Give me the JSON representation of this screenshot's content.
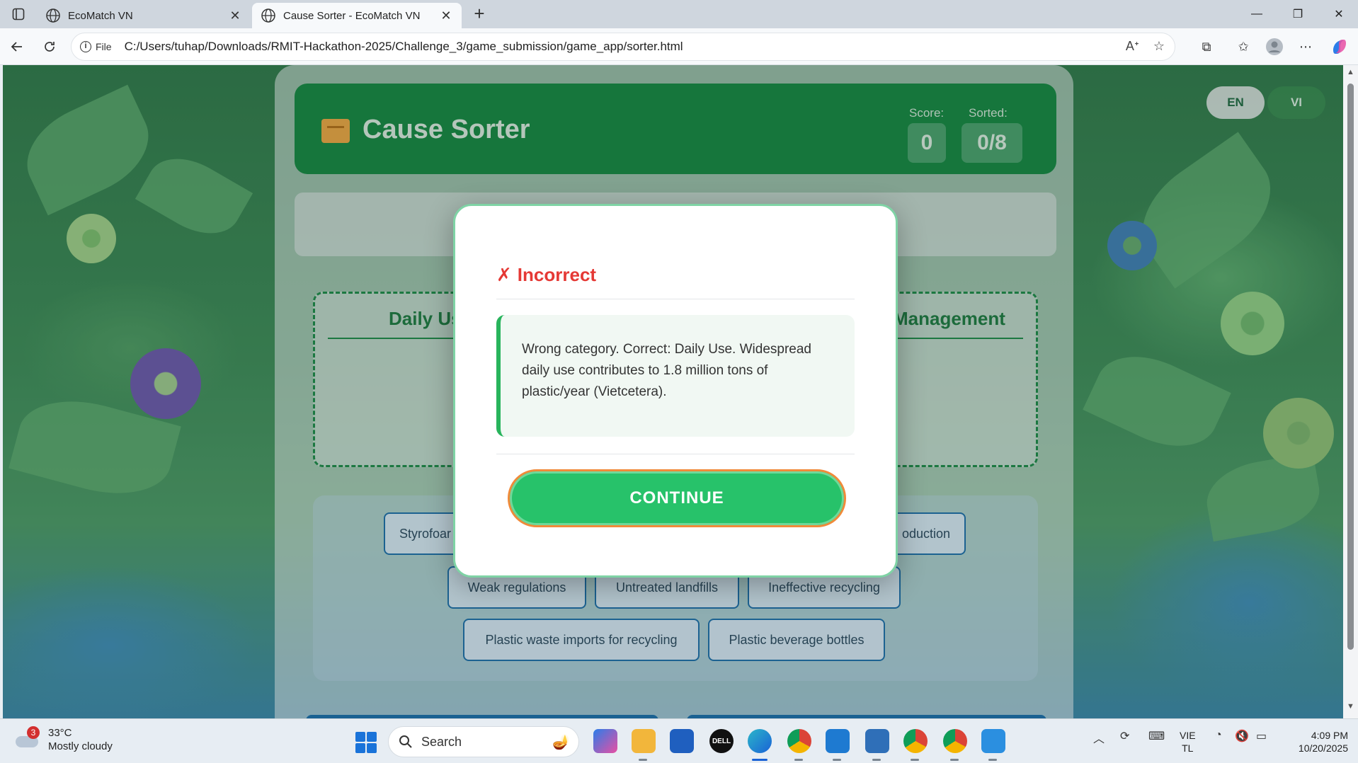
{
  "browser": {
    "tabs": [
      {
        "title": "EcoMatch VN",
        "active": false
      },
      {
        "title": "Cause Sorter - EcoMatch VN",
        "active": true
      }
    ],
    "address_label": "File",
    "url": "C:/Users/tuhap/Downloads/RMIT-Hackathon-2025/Challenge_3/game_submission/game_app/sorter.html"
  },
  "game": {
    "title": "Cause Sorter",
    "score_label": "Score:",
    "score_value": "0",
    "sorted_label": "Sorted:",
    "sorted_value": "0/8",
    "lang_en": "EN",
    "lang_vi": "VI",
    "bins": [
      {
        "title": "Daily Us"
      },
      {
        "title": "Management"
      }
    ],
    "chips": [
      {
        "label": "Styrofoar"
      },
      {
        "label": "oduction"
      },
      {
        "label": "Weak regulations"
      },
      {
        "label": "Untreated landfills"
      },
      {
        "label": "Ineffective recycling"
      },
      {
        "label": "Plastic waste imports for recycling"
      },
      {
        "label": "Plastic beverage bottles"
      }
    ]
  },
  "modal": {
    "status_icon": "✗",
    "status_text": "Incorrect",
    "message": "Wrong category. Correct: Daily Use. Widespread daily use contributes to 1.8 million tons of plastic/year (Vietcetera).",
    "button_label": "CONTINUE",
    "colors": {
      "error": "#e53935",
      "accent": "#27c26a",
      "border": "#f08a3a"
    }
  },
  "taskbar": {
    "weather_badge": "3",
    "temperature": "33°C",
    "condition": "Mostly cloudy",
    "search_placeholder": "Search",
    "lang_line1": "VIE",
    "lang_line2": "TL",
    "time": "4:09 PM",
    "date": "10/20/2025"
  }
}
